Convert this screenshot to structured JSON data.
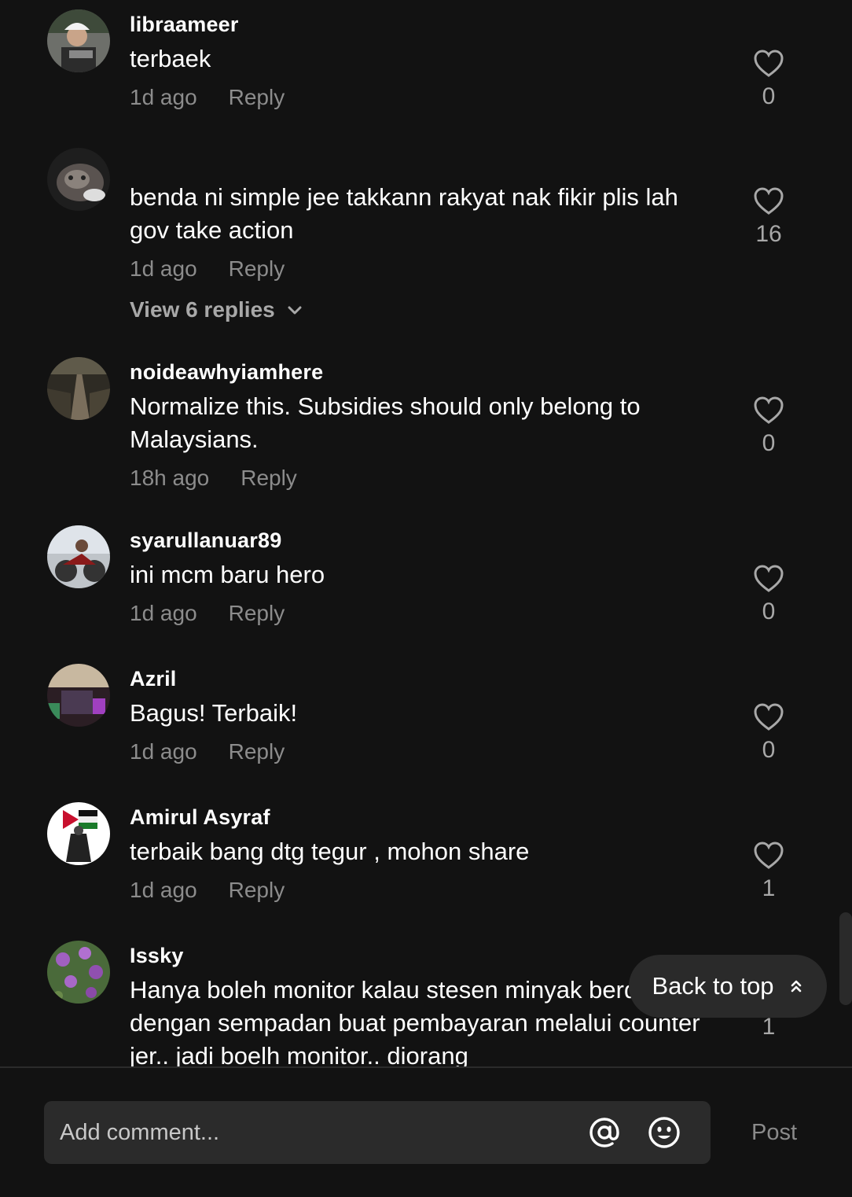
{
  "comments": [
    {
      "username": "libraameer",
      "text": "terbaek",
      "time": "1d ago",
      "reply": "Reply",
      "likes": "0"
    },
    {
      "username": "",
      "text": "benda ni simple jee takkann rakyat nak fikir plis lah gov take action",
      "time": "1d ago",
      "reply": "Reply",
      "likes": "16",
      "view_replies": "View 6 replies"
    },
    {
      "username": "noideawhyiamhere",
      "text": "Normalize this. Subsidies should only belong to Malaysians.",
      "time": "18h ago",
      "reply": "Reply",
      "likes": "0"
    },
    {
      "username": "syarullanuar89",
      "text": "ini mcm baru hero",
      "time": "1d ago",
      "reply": "Reply",
      "likes": "0"
    },
    {
      "username": "Azril",
      "text": "Bagus! Terbaik!",
      "time": "1d ago",
      "reply": "Reply",
      "likes": "0"
    },
    {
      "username": "Amirul Asyraf",
      "text": "terbaik bang dtg tegur , mohon share",
      "time": "1d ago",
      "reply": "Reply",
      "likes": "1"
    },
    {
      "username": "Issky",
      "text": "Hanya boleh monitor kalau stesen minyak berdekatan dengan sempadan buat pembayaran melalui counter jer.. jadi boelh monitor.. diorang",
      "likes": "1"
    }
  ],
  "back_to_top": {
    "label": "Back to top",
    "icon": "double-chevron-up-icon"
  },
  "composer": {
    "placeholder": "Add comment...",
    "mention_icon": "at-sign-icon",
    "emoji_icon": "smiley-icon",
    "post_label": "Post"
  },
  "colors": {
    "background": "#121212",
    "muted_text": "#8c8c8c",
    "input_bg": "#2b2b2b",
    "pill_bg": "#2a2a2a"
  }
}
